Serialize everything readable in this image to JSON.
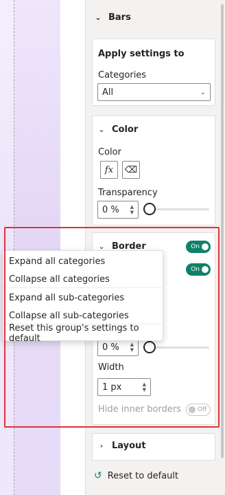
{
  "bars_section": {
    "title": "Bars"
  },
  "apply_settings": {
    "title": "Apply settings to",
    "categories_label": "Categories",
    "categories_value": "All"
  },
  "color_card": {
    "title": "Color",
    "color_label": "Color",
    "fx_label": "fx",
    "transparency_label": "Transparency",
    "transparency_value": "0 %",
    "transparency_level": 0
  },
  "border_card": {
    "title": "Border",
    "toggle_on_label": "On",
    "transparency_value": "0 %",
    "transparency_level": 0,
    "width_label": "Width",
    "width_value": "1 px",
    "hide_inner_label": "Hide inner borders",
    "hide_inner_toggle_label": "Off"
  },
  "context_menu": {
    "items": [
      "Expand all categories",
      "Collapse all categories",
      "Expand all sub-categories",
      "Collapse all sub-categories",
      "Reset this group's settings to default"
    ]
  },
  "layout_section": {
    "title": "Layout"
  },
  "reset_default": {
    "label": "Reset to default"
  },
  "colors": {
    "toggle_on": "#11806a",
    "highlight": "#e0303a",
    "canvas_tint": "#e4d8f6"
  }
}
